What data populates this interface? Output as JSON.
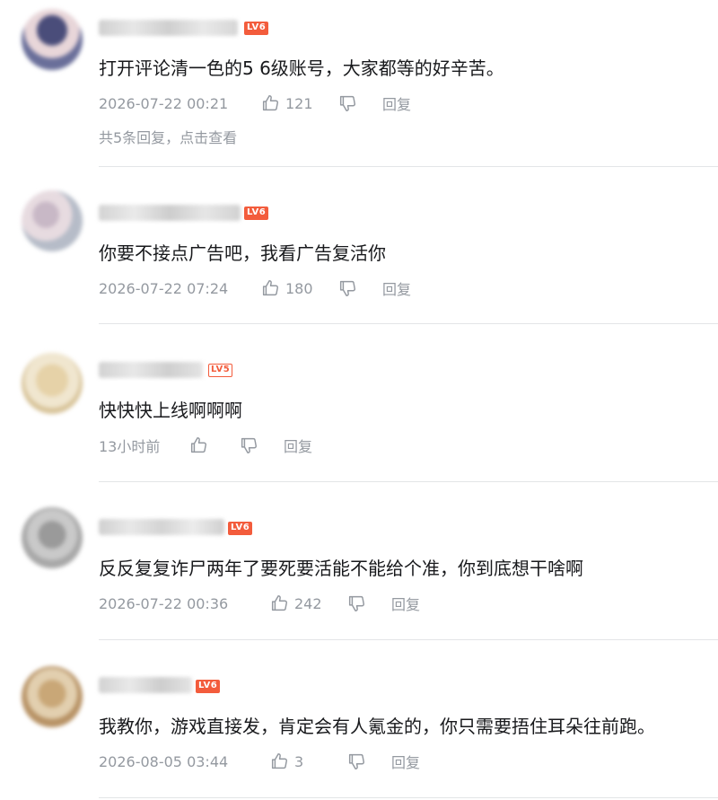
{
  "comments": [
    {
      "text": "打开评论清一色的5 6级账号，大家都等的好辛苦。",
      "time": "2026-07-22 00:21",
      "likes": "121",
      "reply_label": "回复",
      "level": "LV6",
      "sub_replies": "共5条回复，点击查看"
    },
    {
      "text": "你要不接点广告吧，我看广告复活你",
      "time": "2026-07-22 07:24",
      "likes": "180",
      "reply_label": "回复",
      "level": "LV6"
    },
    {
      "text": "快快快上线啊啊啊",
      "time": "13小时前",
      "likes": "",
      "reply_label": "回复",
      "level": "LV5"
    },
    {
      "text": "反反复复诈尸两年了要死要活能不能给个准，你到底想干啥啊",
      "time": "2026-07-22 00:36",
      "likes": "242",
      "reply_label": "回复",
      "level": "LV6"
    },
    {
      "text": "我教你，游戏直接发，肯定会有人氪金的，你只需要捂住耳朵往前跑。",
      "time": "2026-08-05 03:44",
      "likes": "3",
      "reply_label": "回复",
      "level": "LV6"
    }
  ],
  "colors": {
    "level_badge": "#f35c3c",
    "meta_gray": "#9499a0",
    "text": "#18191c"
  },
  "icons": {
    "like": "thumbs-up-icon",
    "dislike": "thumbs-down-icon"
  }
}
